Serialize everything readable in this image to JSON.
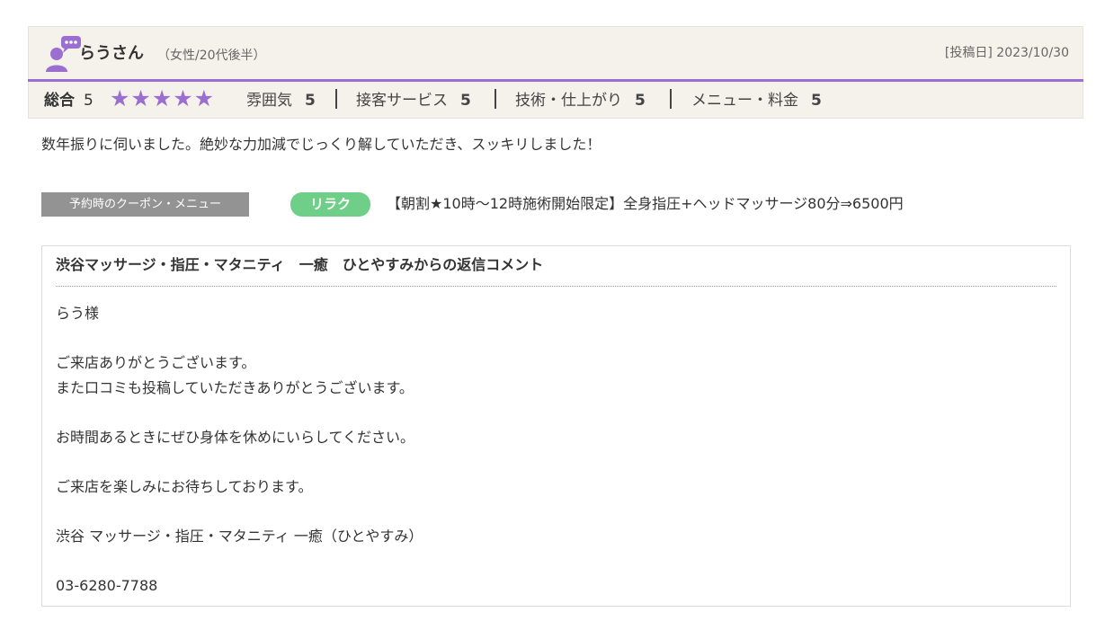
{
  "review": {
    "user_name": "らうさん",
    "user_meta": "（女性/20代後半）",
    "post_date": "[投稿日] 2023/10/30",
    "overall_label": "総合",
    "overall_value": "5",
    "stars_display": "★★★★★",
    "stars_filled": 5,
    "stars_max": 5,
    "ratings": [
      {
        "label": "雰囲気",
        "value": "5"
      },
      {
        "label": "接客サービス",
        "value": "5"
      },
      {
        "label": "技術・仕上がり",
        "value": "5"
      },
      {
        "label": "メニュー・料金",
        "value": "5"
      }
    ],
    "body": "数年振りに伺いました。絶妙な力加減でじっくり解していただき、スッキリしました！"
  },
  "coupon": {
    "section_label": "予約時のクーポン・メニュー",
    "tag": "リラク",
    "title": "【朝割★10時〜12時施術開始限定】全身指圧+ヘッドマッサージ80分⇒6500円"
  },
  "reply": {
    "title": "渋谷マッサージ・指圧・マタニティ　一癒　ひとやすみからの返信コメント",
    "lines": [
      "らう様",
      "ご来店ありがとうございます。",
      "また口コミも投稿していただきありがとうございます。",
      "お時間あるときにぜひ身体を休めにいらしてください。",
      "ご来店を楽しみにお待ちしております。",
      "渋谷 マッサージ・指圧・マタニティ 一癒（ひとやすみ）",
      "03-6280-7788"
    ]
  },
  "colors": {
    "accent_purple": "#9b6fd0",
    "tag_green": "#6fcf88",
    "label_gray": "#939393",
    "header_bg": "#f5f2ec"
  },
  "icons": {
    "user": "user-speech-bubble-icon",
    "star": "star-icon"
  }
}
